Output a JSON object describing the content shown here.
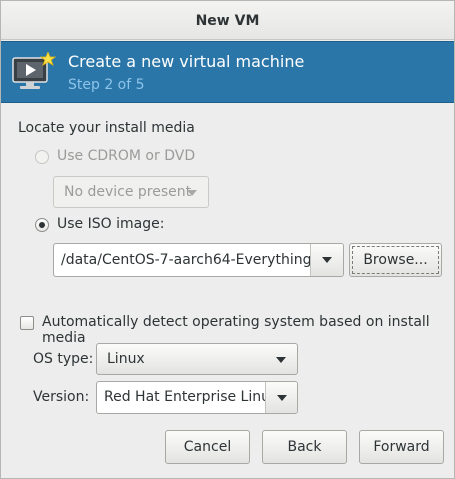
{
  "window": {
    "title": "New VM"
  },
  "header": {
    "title": "Create a new virtual machine",
    "step": "Step 2 of 5",
    "icon": "vm-monitor-icon"
  },
  "install_media": {
    "section_label": "Locate your install media",
    "cdrom": {
      "label": "Use CDROM or DVD",
      "selected": false,
      "enabled": false
    },
    "device_dropdown": {
      "value": "No device present",
      "enabled": false
    },
    "iso": {
      "label": "Use ISO image:",
      "selected": true
    },
    "iso_path": "/data/CentOS-7-aarch64-Everything-",
    "browse_label": "Browse..."
  },
  "os_detection": {
    "auto_detect_label": "Automatically detect operating system based on install media",
    "auto_detect_checked": false,
    "os_type_label": "OS type:",
    "os_type_value": "Linux",
    "version_label": "Version:",
    "version_value": "Red Hat Enterprise Linu"
  },
  "footer": {
    "cancel_label": "Cancel",
    "back_label": "Back",
    "forward_label": "Forward"
  },
  "colors": {
    "header_bg": "#2a76a9",
    "header_step": "#8ec4ea",
    "window_bg": "#ededed"
  }
}
